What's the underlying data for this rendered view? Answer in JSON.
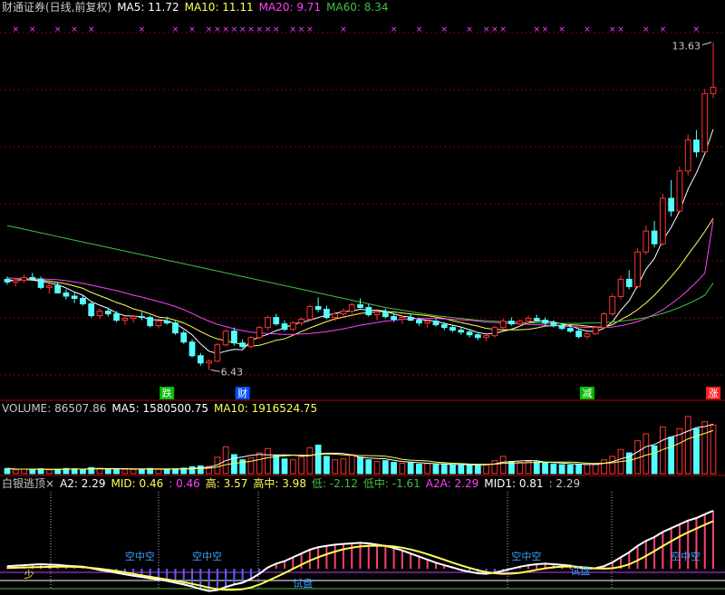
{
  "price_header": {
    "title": "财通证券(日线,前复权)",
    "ma5": "MA5: 11.72",
    "ma10": "MA10: 11.11",
    "ma20": "MA20: 9.71",
    "ma60": "MA60: 8.34"
  },
  "volume_header": {
    "title": "VOLUME: 86507.86",
    "ma5": "MA5: 1580500.75",
    "ma10": "MA10: 1916524.75"
  },
  "indicator_header": {
    "name": "白银逃顶",
    "close": "×",
    "a2": "A2: 2.29",
    "mid": "MID: 0.46",
    "v3": ": 0.46",
    "high": "高: 3.57",
    "high_mid": "高中: 3.98",
    "low": "低: -2.12",
    "low_mid": "低中: -1.61",
    "a2a": "A2A: 2.29",
    "mid1": "MID1: 0.81",
    "v10": ": 2.29"
  },
  "colors": {
    "up": "#ff3232",
    "down": "#54ffff",
    "ma5": "#ffffff",
    "ma10": "#ffff55",
    "ma20": "#ff40ff",
    "ma60": "#40c040",
    "grid": "#8a0000"
  },
  "chart_data": [
    {
      "type": "candlestick",
      "title": "财通证券(日线,前复权)",
      "ylim": [
        5.8,
        14.2
      ],
      "grid": "dashed horizontal",
      "annotations": [
        "13.63",
        "6.43"
      ],
      "markers": [
        "跌",
        "财",
        "减",
        "涨"
      ],
      "ohlc": [
        [
          8.42,
          8.48,
          8.3,
          8.36
        ],
        [
          8.36,
          8.45,
          8.26,
          8.4
        ],
        [
          8.4,
          8.52,
          8.34,
          8.46
        ],
        [
          8.46,
          8.56,
          8.4,
          8.42
        ],
        [
          8.42,
          8.48,
          8.2,
          8.24
        ],
        [
          8.24,
          8.32,
          8.1,
          8.28
        ],
        [
          8.28,
          8.36,
          8.18,
          8.12
        ],
        [
          8.12,
          8.2,
          7.98,
          8.05
        ],
        [
          8.05,
          8.14,
          7.9,
          8.0
        ],
        [
          8.0,
          8.06,
          7.84,
          7.88
        ],
        [
          7.88,
          7.94,
          7.58,
          7.62
        ],
        [
          7.62,
          7.78,
          7.55,
          7.72
        ],
        [
          7.72,
          7.8,
          7.6,
          7.66
        ],
        [
          7.66,
          7.72,
          7.48,
          7.52
        ],
        [
          7.52,
          7.6,
          7.42,
          7.56
        ],
        [
          7.56,
          7.64,
          7.46,
          7.6
        ],
        [
          7.6,
          7.7,
          7.52,
          7.58
        ],
        [
          7.58,
          7.62,
          7.36,
          7.4
        ],
        [
          7.4,
          7.52,
          7.34,
          7.5
        ],
        [
          7.5,
          7.6,
          7.42,
          7.46
        ],
        [
          7.46,
          7.5,
          7.2,
          7.24
        ],
        [
          7.24,
          7.3,
          7.0,
          7.04
        ],
        [
          7.04,
          7.1,
          6.7,
          6.74
        ],
        [
          6.74,
          6.8,
          6.52,
          6.58
        ],
        [
          6.58,
          6.66,
          6.43,
          6.62
        ],
        [
          6.62,
          7.02,
          6.6,
          6.98
        ],
        [
          6.98,
          7.32,
          6.94,
          7.28
        ],
        [
          7.28,
          7.36,
          6.96,
          7.02
        ],
        [
          7.02,
          7.1,
          6.9,
          6.94
        ],
        [
          6.94,
          7.18,
          6.9,
          7.14
        ],
        [
          7.14,
          7.4,
          7.1,
          7.36
        ],
        [
          7.36,
          7.62,
          7.3,
          7.58
        ],
        [
          7.58,
          7.66,
          7.4,
          7.44
        ],
        [
          7.44,
          7.52,
          7.28,
          7.32
        ],
        [
          7.32,
          7.5,
          7.28,
          7.46
        ],
        [
          7.46,
          7.58,
          7.4,
          7.54
        ],
        [
          7.54,
          7.86,
          7.5,
          7.82
        ],
        [
          7.82,
          8.02,
          7.7,
          7.76
        ],
        [
          7.76,
          7.84,
          7.54,
          7.58
        ],
        [
          7.58,
          7.7,
          7.5,
          7.66
        ],
        [
          7.66,
          7.78,
          7.56,
          7.72
        ],
        [
          7.72,
          7.9,
          7.66,
          7.86
        ],
        [
          7.86,
          8.0,
          7.78,
          7.8
        ],
        [
          7.8,
          7.88,
          7.6,
          7.64
        ],
        [
          7.64,
          7.72,
          7.52,
          7.7
        ],
        [
          7.7,
          7.78,
          7.56,
          7.6
        ],
        [
          7.6,
          7.66,
          7.48,
          7.54
        ],
        [
          7.54,
          7.62,
          7.44,
          7.58
        ],
        [
          7.58,
          7.66,
          7.5,
          7.52
        ],
        [
          7.52,
          7.58,
          7.4,
          7.46
        ],
        [
          7.46,
          7.54,
          7.36,
          7.5
        ],
        [
          7.5,
          7.56,
          7.38,
          7.42
        ],
        [
          7.42,
          7.48,
          7.3,
          7.36
        ],
        [
          7.36,
          7.42,
          7.26,
          7.3
        ],
        [
          7.3,
          7.36,
          7.2,
          7.26
        ],
        [
          7.26,
          7.32,
          7.14,
          7.2
        ],
        [
          7.2,
          7.26,
          7.08,
          7.14
        ],
        [
          7.14,
          7.22,
          7.06,
          7.18
        ],
        [
          7.18,
          7.4,
          7.14,
          7.36
        ],
        [
          7.36,
          7.56,
          7.32,
          7.5
        ],
        [
          7.5,
          7.58,
          7.4,
          7.44
        ],
        [
          7.44,
          7.54,
          7.38,
          7.5
        ],
        [
          7.5,
          7.62,
          7.44,
          7.56
        ],
        [
          7.56,
          7.64,
          7.48,
          7.52
        ],
        [
          7.52,
          7.58,
          7.4,
          7.46
        ],
        [
          7.46,
          7.52,
          7.36,
          7.4
        ],
        [
          7.4,
          7.46,
          7.3,
          7.34
        ],
        [
          7.34,
          7.4,
          7.24,
          7.28
        ],
        [
          7.28,
          7.32,
          7.12,
          7.16
        ],
        [
          7.16,
          7.26,
          7.1,
          7.22
        ],
        [
          7.22,
          7.4,
          7.2,
          7.36
        ],
        [
          7.36,
          7.7,
          7.34,
          7.66
        ],
        [
          7.66,
          8.1,
          7.62,
          8.04
        ],
        [
          8.04,
          8.5,
          7.98,
          8.42
        ],
        [
          8.42,
          8.62,
          8.2,
          8.26
        ],
        [
          8.26,
          9.1,
          8.22,
          9.02
        ],
        [
          9.02,
          9.6,
          8.96,
          9.48
        ],
        [
          9.48,
          9.7,
          9.12,
          9.2
        ],
        [
          9.2,
          10.3,
          9.16,
          10.2
        ],
        [
          10.2,
          10.6,
          9.8,
          9.92
        ],
        [
          9.92,
          10.9,
          9.88,
          10.8
        ],
        [
          10.8,
          11.6,
          10.7,
          11.48
        ],
        [
          11.48,
          11.7,
          11.1,
          11.22
        ],
        [
          11.22,
          12.6,
          11.2,
          12.5
        ],
        [
          12.5,
          13.63,
          12.4,
          12.64
        ]
      ],
      "series": [
        {
          "name": "MA5",
          "values": [
            8.38,
            8.4,
            8.42,
            8.4,
            8.38,
            8.34,
            8.3,
            8.23,
            8.14,
            8.07,
            7.93,
            7.85,
            7.78,
            7.68,
            7.62,
            7.61,
            7.6,
            7.53,
            7.53,
            7.51,
            7.44,
            7.33,
            7.2,
            7.0,
            6.84,
            6.79,
            6.84,
            6.88,
            6.87,
            7.07,
            7.15,
            7.21,
            7.29,
            7.35,
            7.43,
            7.47,
            7.52,
            7.58,
            7.63,
            7.67,
            7.71,
            7.72,
            7.76,
            7.74,
            7.74,
            7.72,
            7.66,
            7.61,
            7.59,
            7.54,
            7.52,
            7.5,
            7.45,
            7.41,
            7.37,
            7.31,
            7.25,
            7.22,
            7.23,
            7.28,
            7.32,
            7.39,
            7.47,
            7.5,
            7.5,
            7.48,
            7.44,
            7.4,
            7.33,
            7.28,
            7.27,
            7.34,
            7.48,
            7.74,
            7.95,
            8.28,
            8.64,
            8.88,
            9.28,
            9.56,
            9.92,
            10.4,
            10.76,
            11.18,
            11.72
          ]
        },
        {
          "name": "MA10",
          "values": [
            8.4,
            8.4,
            8.41,
            8.41,
            8.4,
            8.38,
            8.35,
            8.32,
            8.27,
            8.22,
            8.13,
            8.06,
            7.99,
            7.91,
            7.85,
            7.77,
            7.72,
            7.66,
            7.59,
            7.57,
            7.52,
            7.46,
            7.37,
            7.27,
            7.18,
            7.11,
            7.07,
            7.03,
            6.98,
            6.95,
            6.97,
            7.02,
            7.08,
            7.11,
            7.19,
            7.27,
            7.35,
            7.42,
            7.49,
            7.55,
            7.59,
            7.63,
            7.67,
            7.69,
            7.71,
            7.71,
            7.7,
            7.68,
            7.66,
            7.64,
            7.62,
            7.59,
            7.56,
            7.51,
            7.47,
            7.43,
            7.39,
            7.34,
            7.32,
            7.31,
            7.31,
            7.31,
            7.32,
            7.35,
            7.39,
            7.4,
            7.41,
            7.42,
            7.41,
            7.39,
            7.37,
            7.37,
            7.42,
            7.53,
            7.63,
            7.75,
            7.9,
            8.07,
            8.27,
            8.48,
            8.7,
            8.96,
            9.21,
            9.47,
            9.76
          ]
        },
        {
          "name": "MA20",
          "values": [
            8.45,
            8.44,
            8.44,
            8.43,
            8.43,
            8.42,
            8.41,
            8.39,
            8.36,
            8.33,
            8.29,
            8.25,
            8.21,
            8.17,
            8.12,
            8.07,
            8.03,
            7.98,
            7.93,
            7.88,
            7.82,
            7.75,
            7.67,
            7.58,
            7.5,
            7.43,
            7.38,
            7.33,
            7.29,
            7.26,
            7.24,
            7.23,
            7.22,
            7.21,
            7.21,
            7.22,
            7.23,
            7.25,
            7.27,
            7.3,
            7.33,
            7.37,
            7.41,
            7.44,
            7.47,
            7.5,
            7.52,
            7.54,
            7.55,
            7.56,
            7.56,
            7.56,
            7.55,
            7.54,
            7.53,
            7.52,
            7.5,
            7.48,
            7.47,
            7.46,
            7.45,
            7.44,
            7.43,
            7.42,
            7.41,
            7.4,
            7.39,
            7.38,
            7.37,
            7.36,
            7.36,
            7.36,
            7.37,
            7.4,
            7.44,
            7.49,
            7.56,
            7.65,
            7.75,
            7.88,
            8.02,
            8.18,
            8.36,
            8.55,
            9.71
          ]
        },
        {
          "name": "MA60",
          "values": [
            9.6,
            9.56,
            9.52,
            9.48,
            9.44,
            9.4,
            9.36,
            9.32,
            9.28,
            9.24,
            9.2,
            9.16,
            9.12,
            9.08,
            9.04,
            9.0,
            8.96,
            8.92,
            8.88,
            8.84,
            8.8,
            8.76,
            8.72,
            8.68,
            8.64,
            8.6,
            8.56,
            8.52,
            8.48,
            8.44,
            8.4,
            8.36,
            8.32,
            8.28,
            8.24,
            8.2,
            8.16,
            8.12,
            8.08,
            8.04,
            8.0,
            7.96,
            7.92,
            7.88,
            7.84,
            7.8,
            7.77,
            7.74,
            7.71,
            7.68,
            7.65,
            7.62,
            7.6,
            7.58,
            7.56,
            7.54,
            7.52,
            7.51,
            7.5,
            7.49,
            7.48,
            7.47,
            7.46,
            7.46,
            7.45,
            7.45,
            7.45,
            7.45,
            7.45,
            7.46,
            7.46,
            7.47,
            7.48,
            7.5,
            7.52,
            7.55,
            7.58,
            7.62,
            7.67,
            7.73,
            7.8,
            7.88,
            7.97,
            8.07,
            8.34
          ]
        }
      ]
    },
    {
      "type": "bar",
      "title": "VOLUME: 86507.86",
      "series_names": [
        "VOLUME",
        "MA5",
        "MA10"
      ],
      "values": [
        0.3,
        0.22,
        0.26,
        0.24,
        0.28,
        0.22,
        0.25,
        0.3,
        0.28,
        0.26,
        0.35,
        0.3,
        0.28,
        0.27,
        0.25,
        0.24,
        0.26,
        0.3,
        0.25,
        0.24,
        0.28,
        0.32,
        0.4,
        0.45,
        0.42,
        0.95,
        1.55,
        1.1,
        0.8,
        0.9,
        1.2,
        1.45,
        1.05,
        0.85,
        0.8,
        0.95,
        1.5,
        1.65,
        1.0,
        0.8,
        0.85,
        1.1,
        0.95,
        0.8,
        0.7,
        0.75,
        0.65,
        0.6,
        0.62,
        0.55,
        0.58,
        0.52,
        0.55,
        0.5,
        0.48,
        0.52,
        0.5,
        0.55,
        0.75,
        1.0,
        0.7,
        0.65,
        0.7,
        0.68,
        0.62,
        0.55,
        0.52,
        0.5,
        0.55,
        0.52,
        0.55,
        0.8,
        1.0,
        1.4,
        1.2,
        1.9,
        2.3,
        1.6,
        2.7,
        2.1,
        2.6,
        3.3,
        2.6,
        3.0,
        2.8
      ],
      "ma5": [
        1.58
      ],
      "ma10": [
        1.92
      ]
    },
    {
      "type": "area",
      "title": "白银逃顶",
      "labels": [
        "空中空",
        "空中空",
        "空中空",
        "空中空",
        "试盘",
        "试盘",
        "少"
      ],
      "series": [
        {
          "name": "A2",
          "values": [
            0.1,
            0.12,
            0.14,
            0.16,
            0.18,
            0.16,
            0.15,
            0.12,
            0.1,
            0.08,
            0.02,
            -0.05,
            -0.1,
            -0.16,
            -0.22,
            -0.28,
            -0.32,
            -0.38,
            -0.42,
            -0.48,
            -0.55,
            -0.62,
            -0.7,
            -0.8,
            -0.88,
            -0.84,
            -0.72,
            -0.62,
            -0.55,
            -0.4,
            -0.2,
            0.05,
            0.2,
            0.3,
            0.45,
            0.6,
            0.75,
            0.85,
            0.9,
            0.95,
            0.98,
            1.0,
            1.02,
            1.0,
            0.95,
            0.9,
            0.82,
            0.72,
            0.6,
            0.48,
            0.36,
            0.24,
            0.14,
            0.05,
            -0.05,
            -0.12,
            -0.18,
            -0.2,
            -0.15,
            -0.08,
            0.0,
            0.08,
            0.14,
            0.18,
            0.2,
            0.18,
            0.15,
            0.12,
            0.05,
            0.0,
            0.02,
            0.1,
            0.25,
            0.45,
            0.65,
            0.9,
            1.1,
            1.25,
            1.45,
            1.6,
            1.75,
            1.9,
            2.0,
            2.15,
            2.29
          ]
        }
      ]
    }
  ]
}
